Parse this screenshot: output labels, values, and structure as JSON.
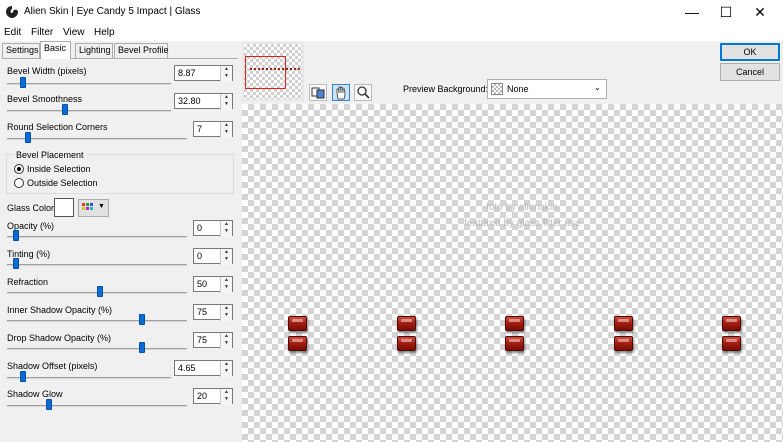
{
  "window": {
    "title": "Alien Skin | Eye Candy 5 Impact | Glass",
    "minimize_glyph": "—",
    "maximize_glyph": "☐",
    "close_glyph": "✕"
  },
  "menu": [
    "Edit",
    "Filter",
    "View",
    "Help"
  ],
  "tabs": [
    "Settings",
    "Basic",
    "Lighting",
    "Bevel Profile"
  ],
  "active_tab": "Basic",
  "controls": {
    "bevel_width": {
      "label": "Bevel Width (pixels)",
      "value": "8.87"
    },
    "bevel_smoothness": {
      "label": "Bevel Smoothness",
      "value": "32.80"
    },
    "round_corners": {
      "label": "Round Selection Corners",
      "value": "7"
    },
    "bevel_placement": {
      "label": "Bevel Placement",
      "inside": "Inside Selection",
      "outside": "Outside Selection",
      "selected": "inside"
    },
    "glass_color": {
      "label": "Glass Color",
      "swatch": "#ffffff"
    },
    "opacity": {
      "label": "Opacity (%)",
      "value": "0"
    },
    "tinting": {
      "label": "Tinting (%)",
      "value": "0"
    },
    "refraction": {
      "label": "Refraction",
      "value": "50"
    },
    "inner_shadow": {
      "label": "Inner Shadow Opacity (%)",
      "value": "75"
    },
    "drop_shadow": {
      "label": "Drop Shadow Opacity (%)",
      "value": "75"
    },
    "shadow_offset": {
      "label": "Shadow Offset (pixels)",
      "value": "4.65"
    },
    "shadow_glow": {
      "label": "Shadow Glow",
      "value": "20"
    }
  },
  "buttons": {
    "ok": "OK",
    "cancel": "Cancel"
  },
  "preview": {
    "background_label": "Preview Background:",
    "background_value": "None",
    "watermark_line1": "foto by alienskin",
    "watermark_line2": "featured by glass filter use"
  },
  "colors": {
    "accent": "#0078d7",
    "gem": "#a51e12",
    "slider_thumb": "#0a6cd4"
  }
}
